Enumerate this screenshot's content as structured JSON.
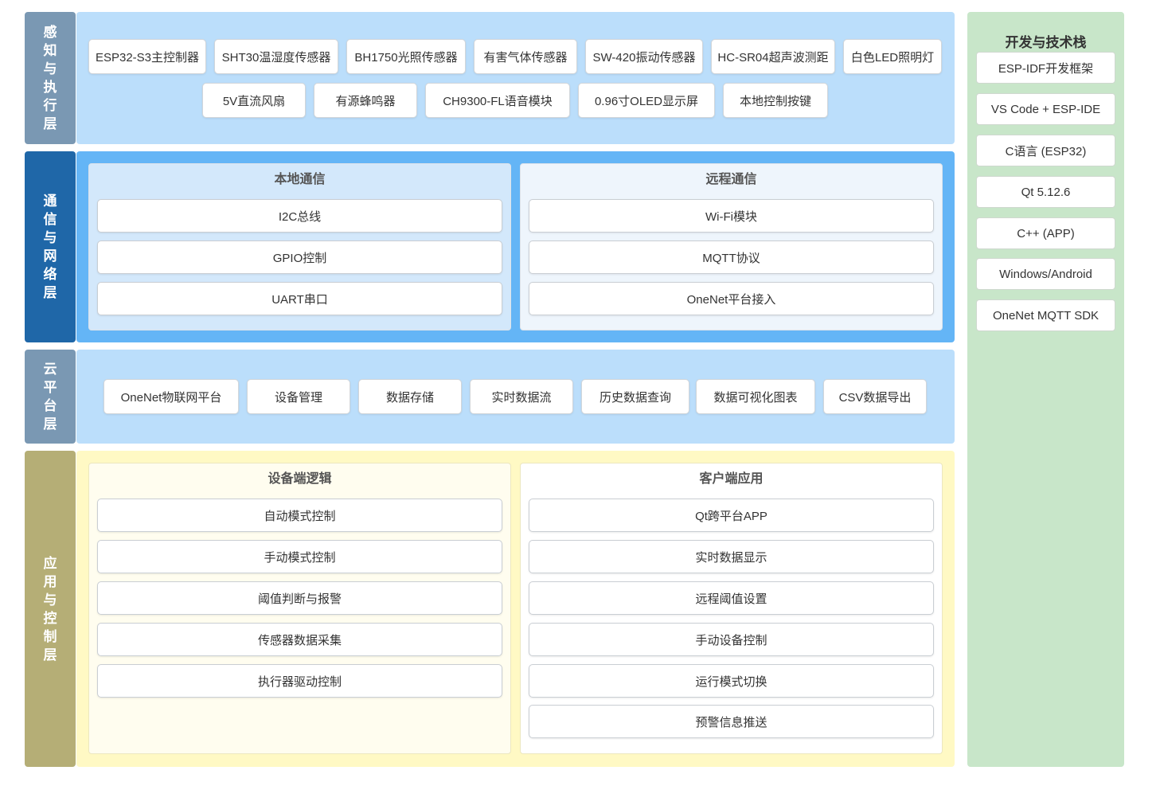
{
  "layers": {
    "perception": {
      "label": "感知与执行层",
      "items": [
        "ESP32-S3主控制器",
        "SHT30温湿度传感器",
        "BH1750光照传感器",
        "有害气体传感器",
        "SW-420振动传感器",
        "HC-SR04超声波测距",
        "白色LED照明灯",
        "5V直流风扇",
        "有源蜂鸣器",
        "CH9300-FL语音模块",
        "0.96寸OLED显示屏",
        "本地控制按键"
      ]
    },
    "network": {
      "label": "通信与网络层",
      "local": {
        "title": "本地通信",
        "items": [
          "I2C总线",
          "GPIO控制",
          "UART串口"
        ]
      },
      "remote": {
        "title": "远程通信",
        "items": [
          "Wi-Fi模块",
          "MQTT协议",
          "OneNet平台接入"
        ]
      }
    },
    "cloud": {
      "label": "云平台层",
      "items": [
        "OneNet物联网平台",
        "设备管理",
        "数据存储",
        "实时数据流",
        "历史数据查询",
        "数据可视化图表",
        "CSV数据导出"
      ]
    },
    "application": {
      "label": "应用与控制层",
      "device": {
        "title": "设备端逻辑",
        "items": [
          "自动模式控制",
          "手动模式控制",
          "阈值判断与报警",
          "传感器数据采集",
          "执行器驱动控制"
        ]
      },
      "client": {
        "title": "客户端应用",
        "items": [
          "Qt跨平台APP",
          "实时数据显示",
          "远程阈值设置",
          "手动设备控制",
          "运行模式切换",
          "预警信息推送"
        ]
      }
    }
  },
  "tech_stack": {
    "title": "开发与技术栈",
    "items": [
      "ESP-IDF开发框架",
      "VS Code + ESP-IDE",
      "C语言 (ESP32)",
      "Qt 5.12.6",
      "C++ (APP)",
      "Windows/Android",
      "OneNet MQTT SDK"
    ]
  },
  "colors": {
    "perception_label": "#7a98b3",
    "perception_panel": "#bbdefb",
    "network_label": "#1f67a8",
    "network_panel": "#64b5f6",
    "cloud_label": "#7a98b3",
    "cloud_panel": "#bbdefb",
    "application_label": "#b5ae76",
    "application_panel": "#fff9c4",
    "tech_panel": "#c8e6c9"
  }
}
